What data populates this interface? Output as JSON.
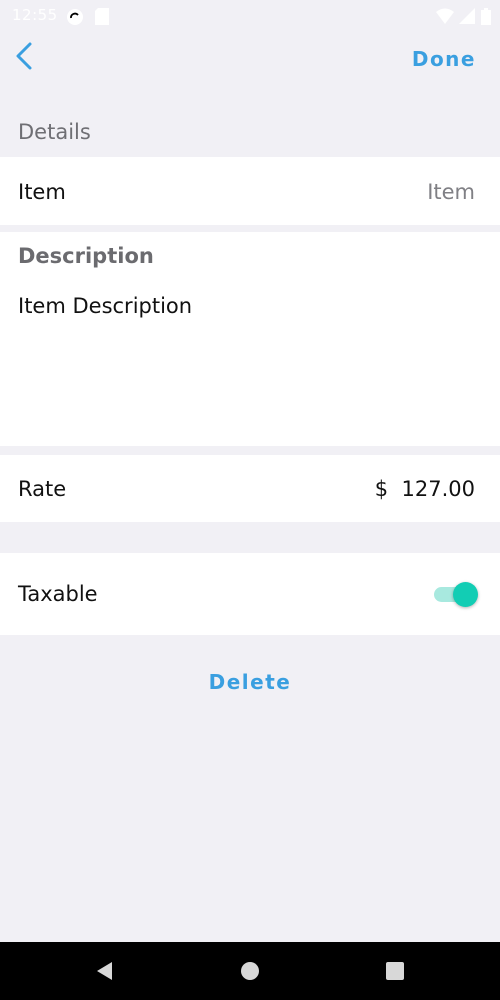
{
  "status_bar": {
    "time": "12:55",
    "icons": [
      "cloud-sync-icon",
      "sd-card-icon",
      "wifi-icon",
      "cellular-signal-icon",
      "battery-icon"
    ]
  },
  "header": {
    "back_icon": "chevron-left-icon",
    "done_label": "Done"
  },
  "details": {
    "section_title": "Details",
    "item_label": "Item",
    "item_placeholder": "Item",
    "description_title": "Description",
    "description_text": "Item Description",
    "rate_label": "Rate",
    "rate_currency": "$",
    "rate_value": "127.00",
    "taxable_label": "Taxable",
    "taxable_on": true
  },
  "actions": {
    "delete_label": "Delete"
  },
  "nav_bar": {
    "icons": [
      "back-triangle-icon",
      "home-circle-icon",
      "recents-square-icon"
    ]
  },
  "colors": {
    "accent": "#3a9fe0",
    "toggle_on": "#12cdb4",
    "background": "#f1f0f5"
  }
}
